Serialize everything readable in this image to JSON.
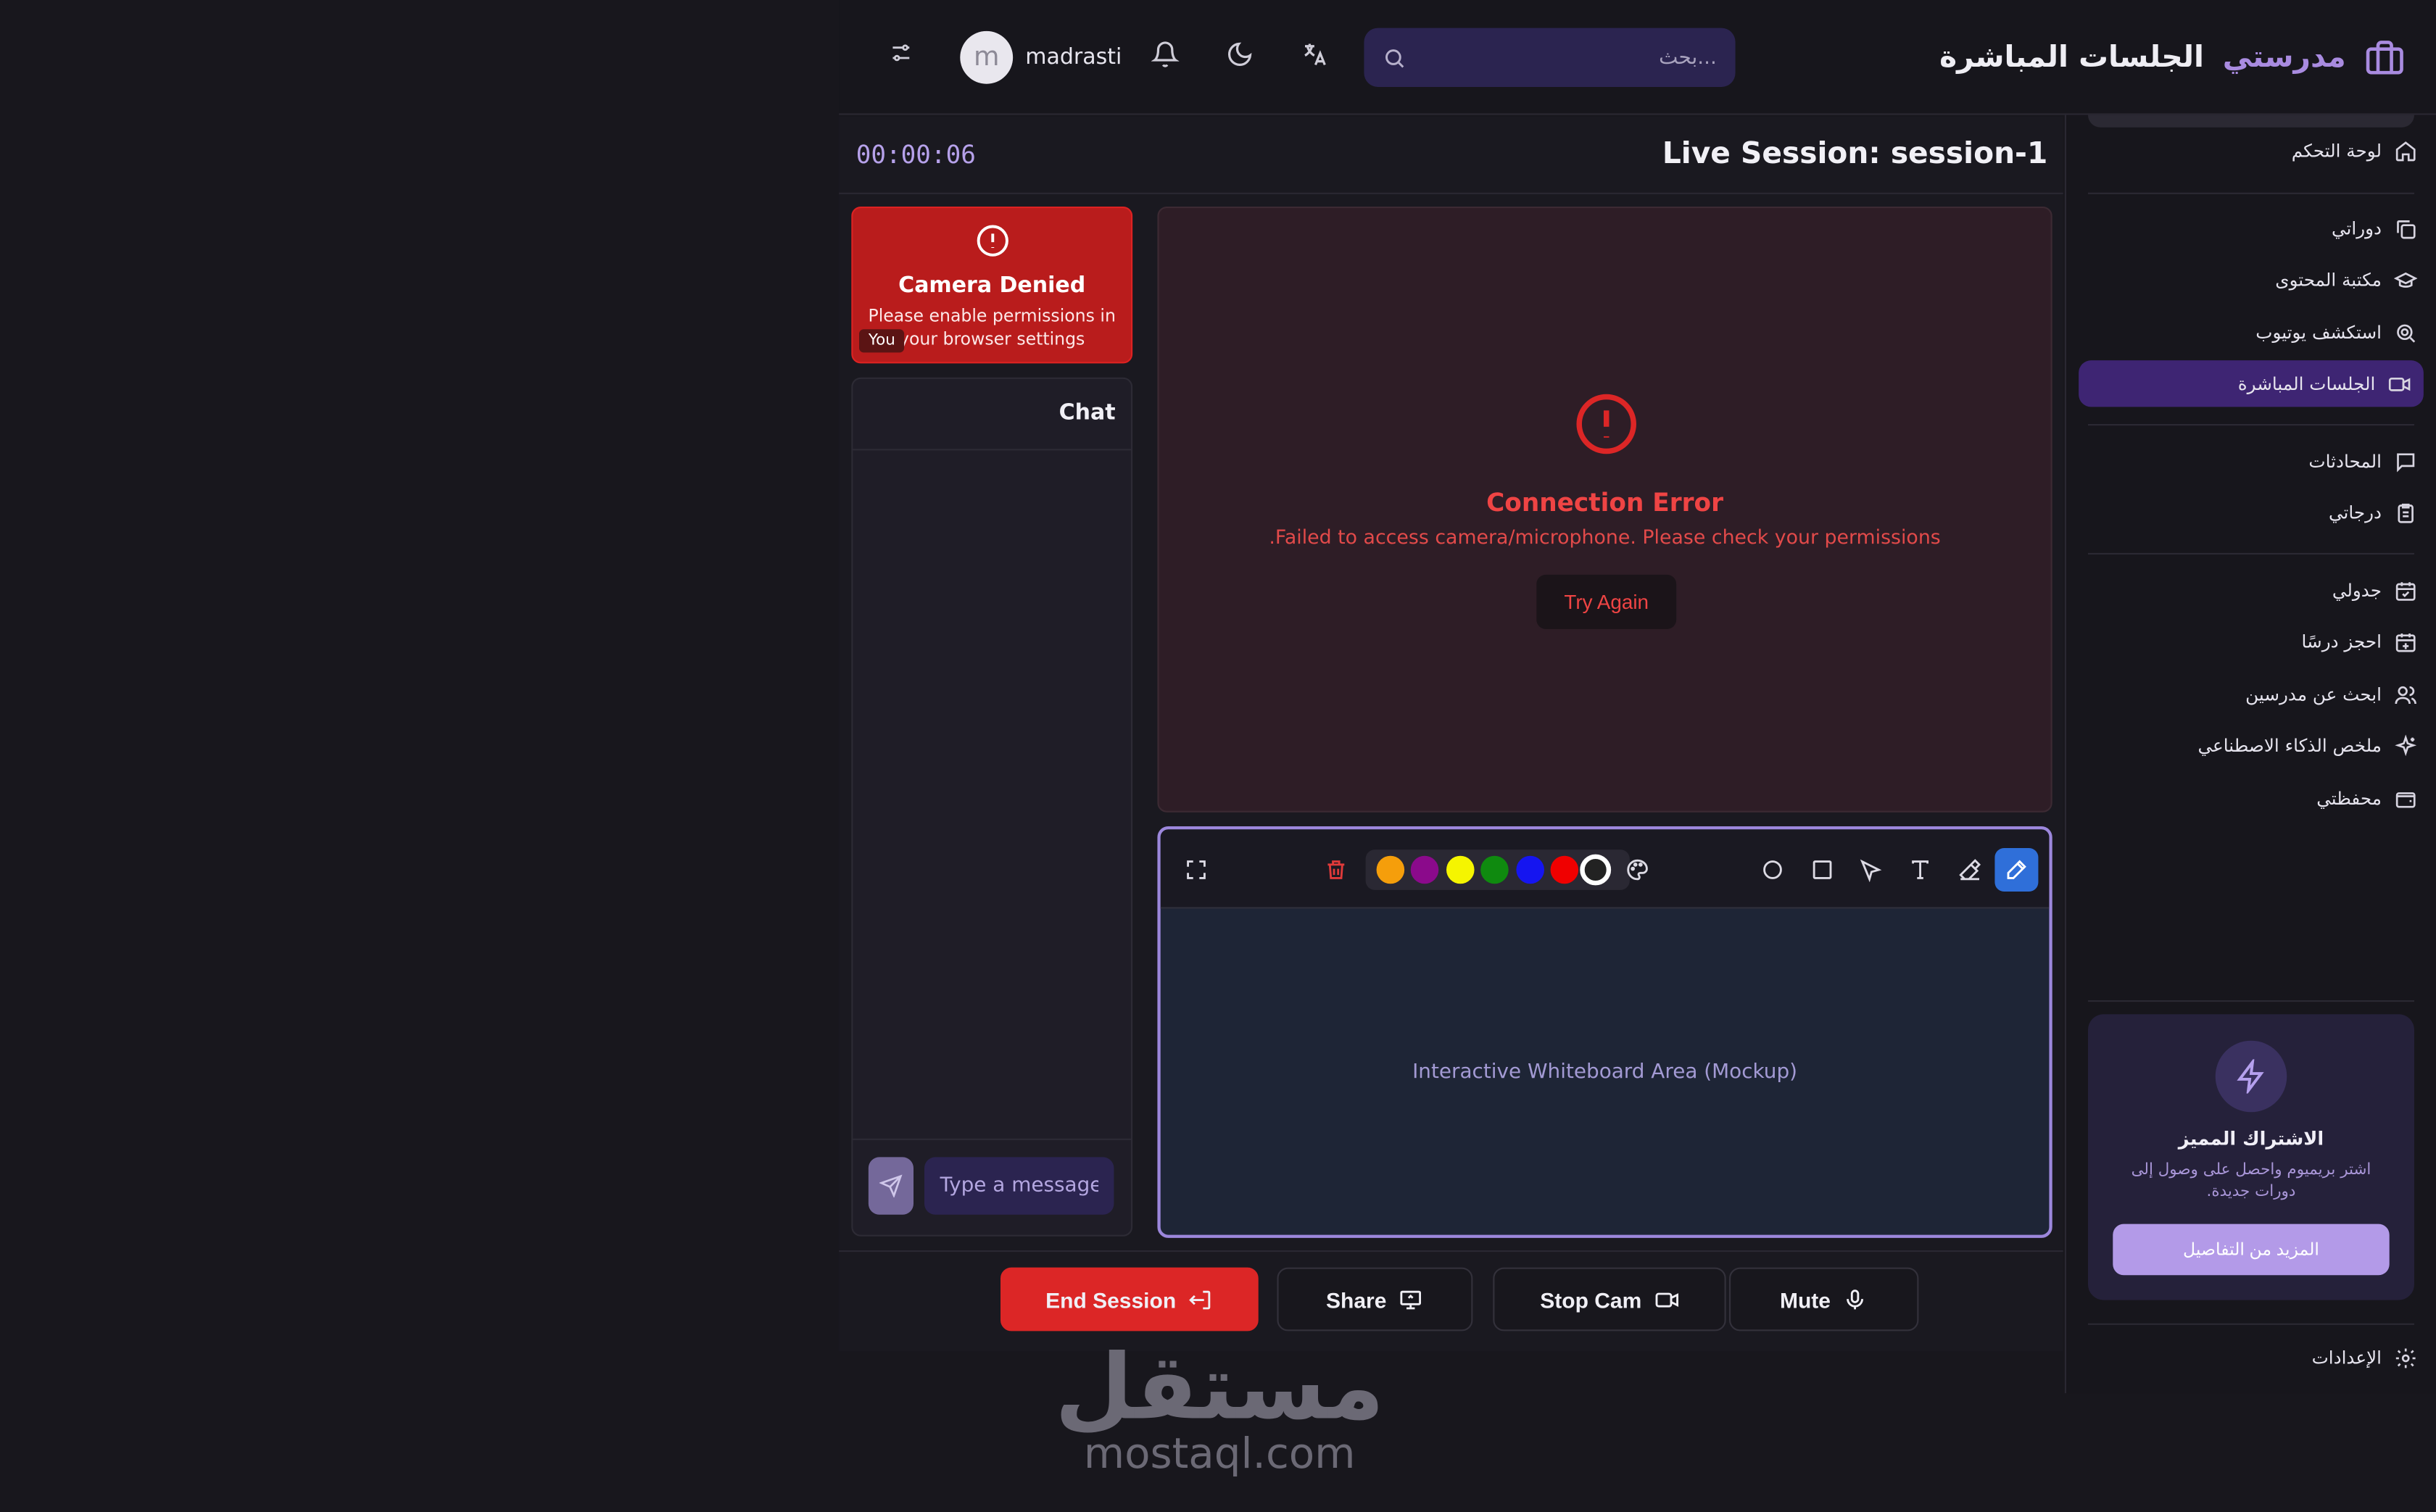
{
  "header": {
    "brand_name": "مدرستي",
    "page_title": "الجلسات المباشرة",
    "search_placeholder": "بحث...",
    "user_initial": "m",
    "username": "madrasti"
  },
  "sidebar": {
    "items": [
      {
        "label": "لوحة التحكم",
        "icon": "home-icon"
      },
      {
        "label": "دوراتي",
        "icon": "copy-icon"
      },
      {
        "label": "مكتبة المحتوى",
        "icon": "graduation-cap-icon"
      },
      {
        "label": "استكشف يوتيوب",
        "icon": "search-zoom-icon"
      },
      {
        "label": "الجلسات المباشرة",
        "icon": "video-icon",
        "active": true
      },
      {
        "label": "المحادثات",
        "icon": "message-icon"
      },
      {
        "label": "درجاتي",
        "icon": "clipboard-icon"
      },
      {
        "label": "جدولي",
        "icon": "calendar-check-icon"
      },
      {
        "label": "احجز درسًا",
        "icon": "calendar-plus-icon"
      },
      {
        "label": "ابحث عن مدرسين",
        "icon": "users-icon"
      },
      {
        "label": "ملخص الذكاء الاصطناعي",
        "icon": "sparkles-icon"
      },
      {
        "label": "محفظتي",
        "icon": "wallet-icon"
      }
    ],
    "premium": {
      "title": "الاشتراك المميز",
      "description": "اشتر بريميوم واحصل على وصول إلى دورات جديدة.",
      "button": "المزيد من التفاصيل"
    },
    "settings_label": "الإعدادات"
  },
  "session": {
    "timer": "00:00:06",
    "title": "Live Session: session-1"
  },
  "camera": {
    "title": "Camera Denied",
    "message": "Please enable permissions in your browser settings",
    "you_label": "You"
  },
  "chat": {
    "title": "Chat",
    "input_placeholder": "Type a message"
  },
  "video": {
    "error_title": "Connection Error",
    "error_message": ".Failed to access camera/microphone. Please check your permissions",
    "retry_label": "Try Again"
  },
  "whiteboard": {
    "area_text": "Interactive Whiteboard Area (Mockup)",
    "colors": [
      "#f59e0b",
      "#8b0a8b",
      "#f5f500",
      "#0f8a0f",
      "#1515f0",
      "#f00000"
    ]
  },
  "controls": {
    "end_label": "End Session",
    "share_label": "Share",
    "stopcam_label": "Stop Cam",
    "mute_label": "Mute"
  },
  "watermark": {
    "arabic": "مستقل",
    "latin": "mostaql.com"
  }
}
